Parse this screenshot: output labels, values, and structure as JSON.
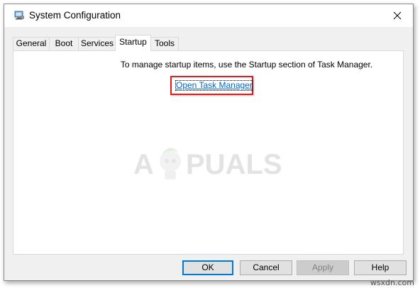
{
  "window": {
    "title": "System Configuration",
    "icon": "system-configuration-icon",
    "close_icon": "close-icon"
  },
  "tabs": [
    {
      "label": "General",
      "active": false
    },
    {
      "label": "Boot",
      "active": false
    },
    {
      "label": "Services",
      "active": false
    },
    {
      "label": "Startup",
      "active": true
    },
    {
      "label": "Tools",
      "active": false
    }
  ],
  "startup": {
    "info_text": "To manage startup items, use the Startup section of Task Manager.",
    "link_label": "Open Task Manager"
  },
  "watermark": {
    "text_left": "A",
    "text_right": "PUALS"
  },
  "buttons": {
    "ok": "OK",
    "cancel": "Cancel",
    "apply": "Apply",
    "help": "Help"
  },
  "credit": "wsxdn.com",
  "colors": {
    "highlight_box": "#e01b1b",
    "link": "#0066cc",
    "default_button_border": "#0078d7"
  }
}
